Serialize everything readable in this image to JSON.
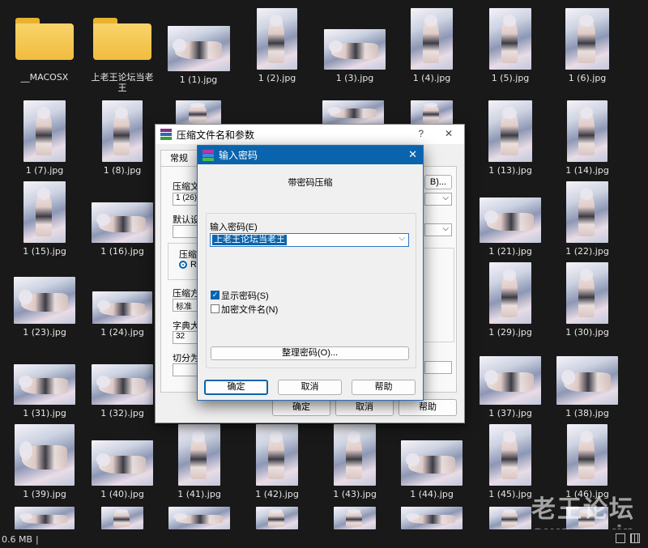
{
  "files": [
    {
      "name": "__MACOSX",
      "type": "folder"
    },
    {
      "name": "上老王论坛当老王",
      "type": "folder"
    },
    {
      "name": "1 (1).jpg"
    },
    {
      "name": "1 (2).jpg"
    },
    {
      "name": "1 (3).jpg"
    },
    {
      "name": "1 (4).jpg"
    },
    {
      "name": "1 (5).jpg"
    },
    {
      "name": "1 (6).jpg"
    },
    {
      "name": "1 (7).jpg"
    },
    {
      "name": "1 (8).jpg"
    },
    {
      "name": "1 (13).jpg"
    },
    {
      "name": "1 (14).jpg"
    },
    {
      "name": "1 (15).jpg"
    },
    {
      "name": "1 (16).jpg"
    },
    {
      "name": "1 (21).jpg"
    },
    {
      "name": "1 (22).jpg"
    },
    {
      "name": "1 (23).jpg"
    },
    {
      "name": "1 (24).jpg"
    },
    {
      "name": "1 (29).jpg"
    },
    {
      "name": "1 (30).jpg"
    },
    {
      "name": "1 (31).jpg"
    },
    {
      "name": "1 (32).jpg"
    },
    {
      "name": "1 (37).jpg"
    },
    {
      "name": "1 (38).jpg"
    },
    {
      "name": "1 (39).jpg"
    },
    {
      "name": "1 (40).jpg"
    },
    {
      "name": "1 (41).jpg"
    },
    {
      "name": "1 (42).jpg"
    },
    {
      "name": "1 (43).jpg"
    },
    {
      "name": "1 (44).jpg"
    },
    {
      "name": "1 (45).jpg"
    },
    {
      "name": "1 (46).jpg"
    }
  ],
  "back_dialog": {
    "title": "压缩文件名和参数",
    "help": "?",
    "close": "✕",
    "tab_general": "常规",
    "archive_name_label": "压缩文",
    "archive_name_value": "1 (26).",
    "browse_label": "B)...",
    "default_profile_label": "默认设",
    "archive_format_label": "压缩",
    "radio_label": "R",
    "compression_method_label": "压缩方",
    "compression_method_value": "标准",
    "dictionary_label": "字典大",
    "dictionary_value": "32",
    "split_label": "切分为",
    "ok": "确定",
    "cancel": "取消",
    "help_btn": "帮助"
  },
  "dialog": {
    "title": "输入密码",
    "close": "✕",
    "heading": "带密码压缩",
    "password_label": "输入密码(E)",
    "password_value": "上老王论坛当老王",
    "show_password": "显示密码(S)",
    "show_password_checked": true,
    "encrypt_names": "加密文件名(N)",
    "encrypt_names_checked": false,
    "organize": "整理密码(O)...",
    "ok": "确定",
    "cancel": "取消",
    "help": "帮助"
  },
  "watermark": {
    "line1": "老王论坛",
    "line2": "laowang.vip"
  },
  "status": {
    "size": "0.6 MB",
    "sep": "|"
  }
}
